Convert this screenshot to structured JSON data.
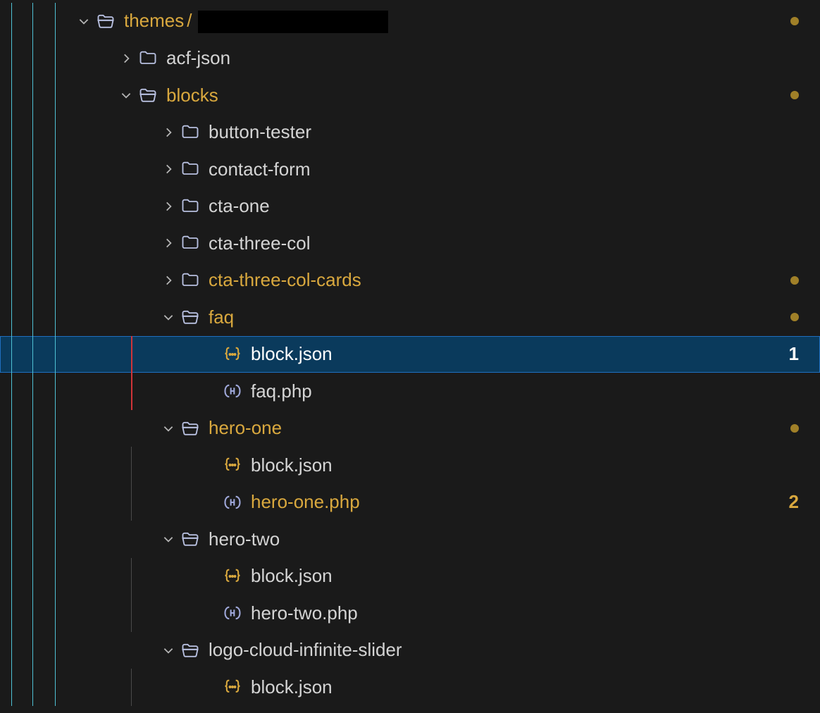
{
  "tree": {
    "root": {
      "label": "themes",
      "slash": "/",
      "modified": true,
      "hasDot": true
    },
    "items": [
      {
        "type": "folder",
        "label": "acf-json",
        "expanded": false,
        "modified": false,
        "indent": 2
      },
      {
        "type": "folder",
        "label": "blocks",
        "expanded": true,
        "modified": true,
        "hasDot": true,
        "indent": 2
      },
      {
        "type": "folder",
        "label": "button-tester",
        "expanded": false,
        "modified": false,
        "indent": 3
      },
      {
        "type": "folder",
        "label": "contact-form",
        "expanded": false,
        "modified": false,
        "indent": 3
      },
      {
        "type": "folder",
        "label": "cta-one",
        "expanded": false,
        "modified": false,
        "indent": 3
      },
      {
        "type": "folder",
        "label": "cta-three-col",
        "expanded": false,
        "modified": false,
        "indent": 3
      },
      {
        "type": "folder",
        "label": "cta-three-col-cards",
        "expanded": false,
        "modified": true,
        "hasDot": true,
        "indent": 3
      },
      {
        "type": "folder",
        "label": "faq",
        "expanded": true,
        "modified": true,
        "hasDot": true,
        "indent": 3
      },
      {
        "type": "file",
        "label": "block.json",
        "filetype": "json",
        "selected": true,
        "badge": "1",
        "badgeColor": "white",
        "indent": 4,
        "redGuide": true
      },
      {
        "type": "file",
        "label": "faq.php",
        "filetype": "php",
        "indent": 4,
        "redGuide": true
      },
      {
        "type": "folder",
        "label": "hero-one",
        "expanded": true,
        "modified": true,
        "hasDot": true,
        "indent": 3
      },
      {
        "type": "file",
        "label": "block.json",
        "filetype": "json",
        "indent": 4
      },
      {
        "type": "file",
        "label": "hero-one.php",
        "filetype": "php",
        "modified": true,
        "badge": "2",
        "badgeColor": "yellow",
        "indent": 4
      },
      {
        "type": "folder",
        "label": "hero-two",
        "expanded": true,
        "modified": false,
        "indent": 3
      },
      {
        "type": "file",
        "label": "block.json",
        "filetype": "json",
        "indent": 4
      },
      {
        "type": "file",
        "label": "hero-two.php",
        "filetype": "php",
        "indent": 4
      },
      {
        "type": "folder",
        "label": "logo-cloud-infinite-slider",
        "expanded": true,
        "modified": false,
        "indent": 3
      },
      {
        "type": "file",
        "label": "block.json",
        "filetype": "json",
        "indent": 4
      }
    ]
  }
}
